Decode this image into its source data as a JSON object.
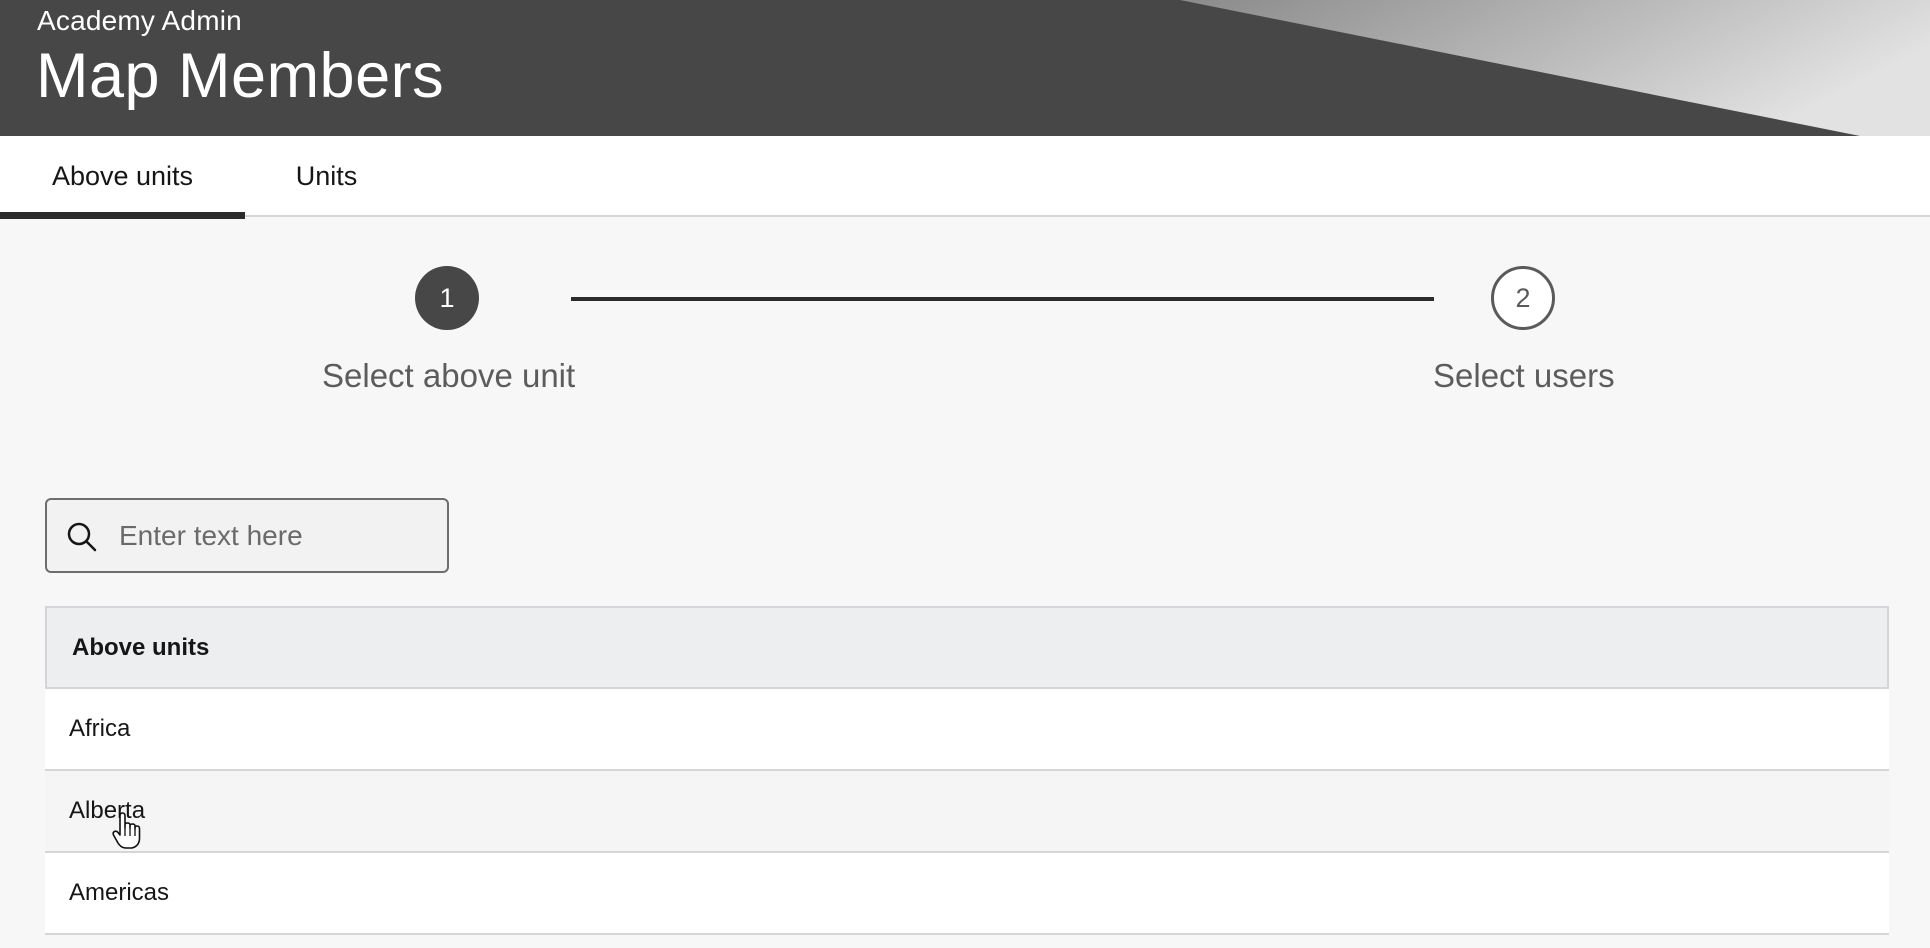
{
  "header": {
    "app_name": "Academy Admin",
    "title": "Map Members"
  },
  "tabs": [
    {
      "label": "Above units",
      "active": true
    },
    {
      "label": "Units",
      "active": false
    }
  ],
  "stepper": {
    "steps": [
      {
        "number": "1",
        "label": "Select above unit",
        "state": "active"
      },
      {
        "number": "2",
        "label": "Select users",
        "state": "pending"
      }
    ]
  },
  "search": {
    "placeholder": "Enter text here",
    "value": "",
    "icon": "search-icon"
  },
  "table": {
    "header": "Above units",
    "rows": [
      "Africa",
      "Alberta",
      "Americas"
    ],
    "hovered_row": "Alberta"
  },
  "colors": {
    "header_bg": "#474747",
    "active_accent": "#2b2b2b",
    "table_header_bg": "#eceef0"
  }
}
